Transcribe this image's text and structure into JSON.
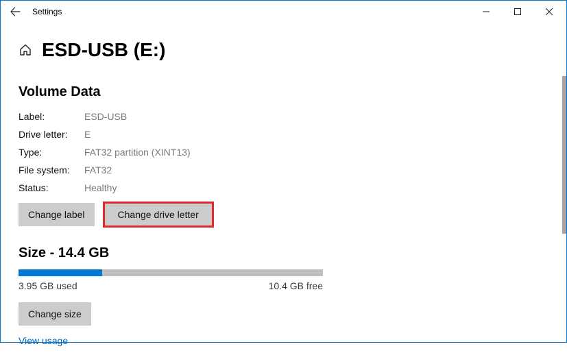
{
  "window": {
    "title": "Settings"
  },
  "page_title": "ESD-USB (E:)",
  "volume_section_heading": "Volume Data",
  "volume": {
    "label_l": "Label:",
    "label_v": "ESD-USB",
    "letter_l": "Drive letter:",
    "letter_v": "E",
    "type_l": "Type:",
    "type_v": "FAT32 partition (XINT13)",
    "fs_l": "File system:",
    "fs_v": "FAT32",
    "status_l": "Status:",
    "status_v": "Healthy"
  },
  "buttons": {
    "change_label": "Change label",
    "change_drive_letter": "Change drive letter",
    "change_size": "Change size"
  },
  "size": {
    "heading": "Size - 14.4 GB",
    "used_label": "3.95 GB used",
    "free_label": "10.4 GB free",
    "percent_used": 27.4
  },
  "link_view_usage": "View usage"
}
